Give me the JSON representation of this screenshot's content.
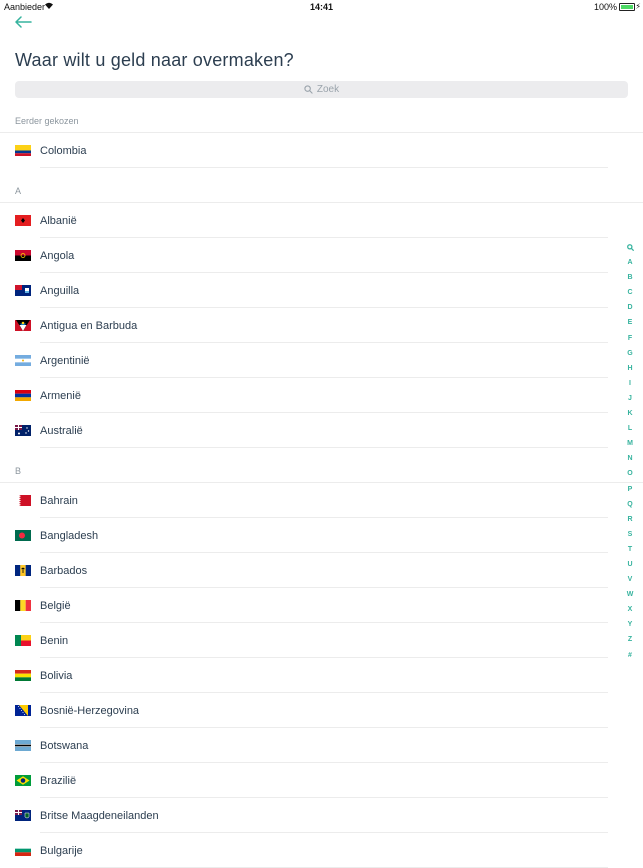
{
  "status": {
    "carrier": "Aanbieder",
    "time": "14:41",
    "battery": "100%"
  },
  "page": {
    "title": "Waar wilt u geld naar overmaken?"
  },
  "search": {
    "placeholder": "Zoek"
  },
  "colors": {
    "accent": "#36b39e",
    "title": "#2c3e50"
  },
  "recent": {
    "header": "Eerder gekozen",
    "items": [
      {
        "name": "Colombia",
        "flag": "colombia"
      }
    ]
  },
  "sections": [
    {
      "letter": "A",
      "items": [
        {
          "name": "Albanië",
          "flag": "albania"
        },
        {
          "name": "Angola",
          "flag": "angola"
        },
        {
          "name": "Anguilla",
          "flag": "anguilla"
        },
        {
          "name": "Antigua en Barbuda",
          "flag": "antigua"
        },
        {
          "name": "Argentinië",
          "flag": "argentina"
        },
        {
          "name": "Armenië",
          "flag": "armenia"
        },
        {
          "name": "Australië",
          "flag": "australia"
        }
      ]
    },
    {
      "letter": "B",
      "items": [
        {
          "name": "Bahrain",
          "flag": "bahrain"
        },
        {
          "name": "Bangladesh",
          "flag": "bangladesh"
        },
        {
          "name": "Barbados",
          "flag": "barbados"
        },
        {
          "name": "België",
          "flag": "belgium"
        },
        {
          "name": "Benin",
          "flag": "benin"
        },
        {
          "name": "Bolivia",
          "flag": "bolivia"
        },
        {
          "name": "Bosnië-Herzegovina",
          "flag": "bosnia"
        },
        {
          "name": "Botswana",
          "flag": "botswana"
        },
        {
          "name": "Brazilië",
          "flag": "brazil"
        },
        {
          "name": "Britse Maagdeneilanden",
          "flag": "bvi"
        },
        {
          "name": "Bulgarije",
          "flag": "bulgaria"
        }
      ]
    }
  ],
  "index": [
    "A",
    "B",
    "C",
    "D",
    "E",
    "F",
    "G",
    "H",
    "I",
    "J",
    "K",
    "L",
    "M",
    "N",
    "O",
    "P",
    "Q",
    "R",
    "S",
    "T",
    "U",
    "V",
    "W",
    "X",
    "Y",
    "Z",
    "#"
  ]
}
